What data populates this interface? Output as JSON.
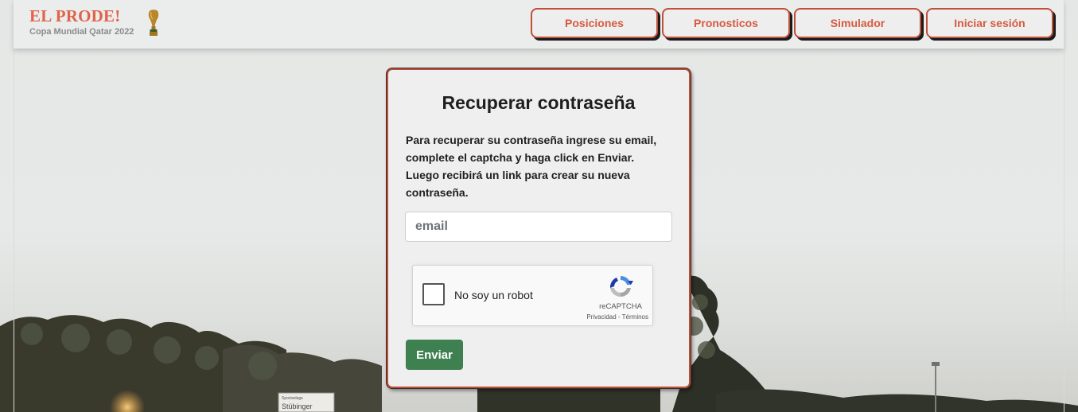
{
  "header": {
    "brand_title": "EL PRODE!",
    "brand_subtitle": "Copa Mundial Qatar 2022",
    "nav": [
      {
        "label": "Posiciones"
      },
      {
        "label": "Pronosticos"
      },
      {
        "label": "Simulador"
      },
      {
        "label": "Iniciar sesión"
      }
    ]
  },
  "card": {
    "title": "Recuperar contraseña",
    "description": "Para recuperar su contraseña ingrese su email, complete el captcha y haga click en Enviar. Luego recibirá un link para crear su nueva contraseña.",
    "email_placeholder": "email",
    "email_value": "",
    "recaptcha": {
      "label": "No soy un robot",
      "brand": "reCAPTCHA",
      "links": "Privacidad - Términos"
    },
    "submit_label": "Enviar"
  },
  "background": {
    "sign_text_small": "Sportanlage",
    "sign_text": "Stübinger"
  },
  "colors": {
    "accent": "#e0634a",
    "nav_text": "#d65a40",
    "submit": "#3f8050"
  }
}
